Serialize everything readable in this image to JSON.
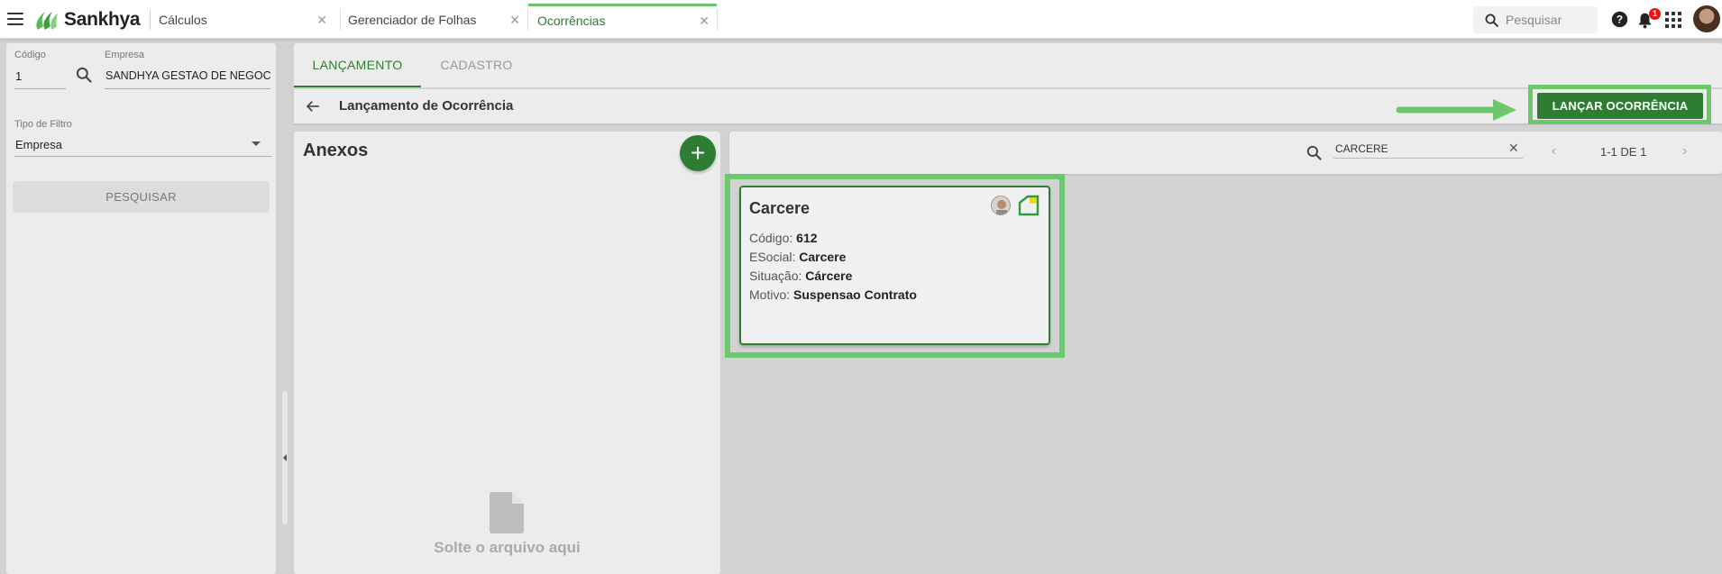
{
  "topbar": {
    "brand": "Sankhya",
    "tabs": [
      {
        "label": "Cálculos"
      },
      {
        "label": "Gerenciador de Folhas"
      },
      {
        "label": "Ocorrências"
      }
    ],
    "search_placeholder": "Pesquisar",
    "notification_count": "1"
  },
  "filters": {
    "codigo_label": "Código",
    "codigo_value": "1",
    "empresa_label": "Empresa",
    "empresa_value": "SANDHYA GESTAO DE NEGOC",
    "tipo_filtro_label": "Tipo de Filtro",
    "tipo_filtro_value": "Empresa",
    "search_button": "PESQUISAR"
  },
  "main": {
    "tabs": [
      {
        "label": "LANÇAMENTO"
      },
      {
        "label": "CADASTRO"
      }
    ],
    "page_title": "Lançamento de Ocorrência",
    "launch_button": "LANÇAR OCORRÊNCIA"
  },
  "attachments": {
    "title": "Anexos",
    "add_button": "+",
    "drop_text": "Solte o arquivo aqui"
  },
  "results": {
    "search_value": "CARCERE",
    "pagination": "1-1 DE 1"
  },
  "card": {
    "title": "Carcere",
    "fields": [
      {
        "label": "Código:",
        "value": "612"
      },
      {
        "label": "ESocial:",
        "value": "Carcere"
      },
      {
        "label": "Situação:",
        "value": "Cárcere"
      },
      {
        "label": "Motivo:",
        "value": "Suspensao Contrato"
      }
    ]
  },
  "colors": {
    "brand_green": "#2e7d32",
    "highlight_green": "#6bc96b",
    "badge_red": "#ee1111"
  }
}
